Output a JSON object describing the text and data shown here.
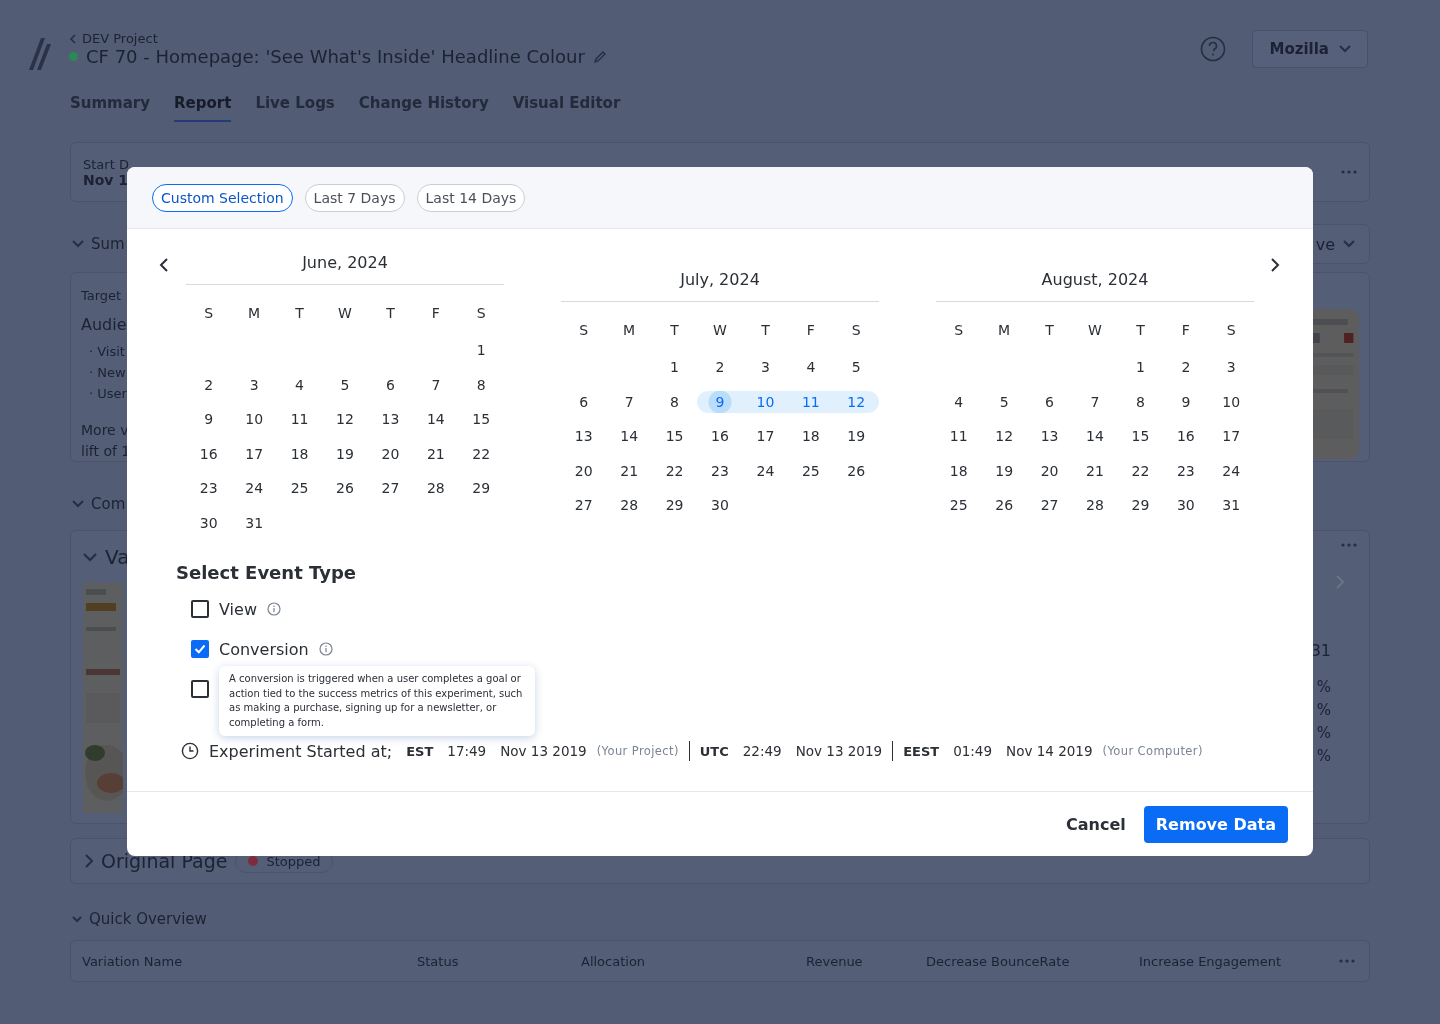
{
  "header": {
    "breadcrumb": "DEV Project",
    "title": "CF 70 - Homepage: 'See What's Inside' Headline Colour",
    "account": "Mozilla"
  },
  "tabs": [
    {
      "label": "Summary",
      "selected": false
    },
    {
      "label": "Report",
      "selected": true
    },
    {
      "label": "Live Logs",
      "selected": false
    },
    {
      "label": "Change History",
      "selected": false
    },
    {
      "label": "Visual Editor",
      "selected": false
    }
  ],
  "stats": {
    "label": "Start D",
    "value": "Nov 1"
  },
  "summary": {
    "title": "Sum",
    "dropdown": "ve",
    "lines": [
      {
        "kind": "label",
        "text": "Target"
      },
      {
        "kind": "heading",
        "text": "Audie"
      },
      {
        "kind": "bullet",
        "text": "· Visit"
      },
      {
        "kind": "bullet",
        "text": "· New"
      },
      {
        "kind": "bullet",
        "text": "· User"
      },
      {
        "kind": "para",
        "text": "More v"
      },
      {
        "kind": "para",
        "text": "lift of 1"
      }
    ]
  },
  "comparison": {
    "title": "Com",
    "variation": "Va",
    "values": [
      "31",
      "%",
      "%",
      "%",
      "%"
    ]
  },
  "original_page": {
    "title": "Original Page",
    "status": "Stopped"
  },
  "quick_overview": {
    "title": "Quick Overview",
    "columns": [
      "Variation Name",
      "Status",
      "Allocation",
      "Revenue",
      "Decrease BounceRate",
      "Increase Engagement"
    ]
  },
  "modal": {
    "presets": [
      {
        "label": "Custom Selection",
        "selected": true
      },
      {
        "label": "Last 7 Days",
        "selected": false
      },
      {
        "label": "Last 14 Days",
        "selected": false
      }
    ],
    "months": [
      {
        "title": "June, 2024",
        "weekdays": [
          "S",
          "M",
          "T",
          "W",
          "T",
          "F",
          "S"
        ],
        "weeks": [
          {
            "kind": "first",
            "days": [
              {
                "label": "1",
                "selected": false
              }
            ]
          },
          {
            "kind": "week",
            "days": [
              {
                "label": "2",
                "selected": false
              },
              {
                "label": "3",
                "selected": false
              },
              {
                "label": "4",
                "selected": false
              },
              {
                "label": "5",
                "selected": false
              },
              {
                "label": "6",
                "selected": false
              },
              {
                "label": "7",
                "selected": false
              },
              {
                "label": "8",
                "selected": false
              }
            ]
          },
          {
            "kind": "week",
            "days": [
              {
                "label": "9",
                "selected": false
              },
              {
                "label": "10",
                "selected": false
              },
              {
                "label": "11",
                "selected": false
              },
              {
                "label": "12",
                "selected": false
              },
              {
                "label": "13",
                "selected": false
              },
              {
                "label": "14",
                "selected": false
              },
              {
                "label": "15",
                "selected": false
              }
            ]
          },
          {
            "kind": "week",
            "days": [
              {
                "label": "16",
                "selected": false
              },
              {
                "label": "17",
                "selected": false
              },
              {
                "label": "18",
                "selected": false
              },
              {
                "label": "19",
                "selected": false
              },
              {
                "label": "20",
                "selected": false
              },
              {
                "label": "21",
                "selected": false
              },
              {
                "label": "22",
                "selected": false
              }
            ]
          },
          {
            "kind": "week",
            "days": [
              {
                "label": "23",
                "selected": false
              },
              {
                "label": "24",
                "selected": false
              },
              {
                "label": "25",
                "selected": false
              },
              {
                "label": "26",
                "selected": false
              },
              {
                "label": "27",
                "selected": false
              },
              {
                "label": "28",
                "selected": false
              },
              {
                "label": "29",
                "selected": false
              }
            ]
          },
          {
            "kind": "week",
            "days": [
              {
                "label": "30",
                "selected": false
              },
              {
                "label": "31",
                "selected": false
              }
            ]
          }
        ]
      },
      {
        "title": "July, 2024",
        "weekdays": [
          "S",
          "M",
          "T",
          "W",
          "T",
          "F",
          "S"
        ],
        "weeks": [
          {
            "kind": "first",
            "days": [
              {
                "label": "1",
                "selected": false
              },
              {
                "label": "2",
                "selected": false
              },
              {
                "label": "3",
                "selected": false
              },
              {
                "label": "4",
                "selected": false
              },
              {
                "label": "5",
                "selected": false
              }
            ]
          },
          {
            "kind": "week",
            "days": [
              {
                "label": "6",
                "selected": false
              },
              {
                "label": "7",
                "selected": false
              },
              {
                "label": "8",
                "selected": false
              },
              {
                "label": "9",
                "selected": true
              },
              {
                "label": "10",
                "selected": true
              },
              {
                "label": "11",
                "selected": true
              },
              {
                "label": "12",
                "selected": true
              }
            ]
          },
          {
            "kind": "week",
            "days": [
              {
                "label": "13",
                "selected": false
              },
              {
                "label": "14",
                "selected": false
              },
              {
                "label": "15",
                "selected": false
              },
              {
                "label": "16",
                "selected": false
              },
              {
                "label": "17",
                "selected": false
              },
              {
                "label": "18",
                "selected": false
              },
              {
                "label": "19",
                "selected": false
              }
            ]
          },
          {
            "kind": "week",
            "days": [
              {
                "label": "20",
                "selected": false
              },
              {
                "label": "21",
                "selected": false
              },
              {
                "label": "22",
                "selected": false
              },
              {
                "label": "23",
                "selected": false
              },
              {
                "label": "24",
                "selected": false
              },
              {
                "label": "25",
                "selected": false
              },
              {
                "label": "26",
                "selected": false
              }
            ]
          },
          {
            "kind": "week",
            "days": [
              {
                "label": "27",
                "selected": false
              },
              {
                "label": "28",
                "selected": false
              },
              {
                "label": "29",
                "selected": false
              },
              {
                "label": "30",
                "selected": false
              }
            ]
          }
        ]
      },
      {
        "title": "August, 2024",
        "weekdays": [
          "S",
          "M",
          "T",
          "W",
          "T",
          "F",
          "S"
        ],
        "weeks": [
          {
            "kind": "first",
            "days": [
              {
                "label": "1",
                "selected": false
              },
              {
                "label": "2",
                "selected": false
              },
              {
                "label": "3",
                "selected": false
              }
            ]
          },
          {
            "kind": "week",
            "days": [
              {
                "label": "4",
                "selected": false
              },
              {
                "label": "5",
                "selected": false
              },
              {
                "label": "6",
                "selected": false
              },
              {
                "label": "7",
                "selected": false
              },
              {
                "label": "8",
                "selected": false
              },
              {
                "label": "9",
                "selected": false
              },
              {
                "label": "10",
                "selected": false
              }
            ]
          },
          {
            "kind": "week",
            "days": [
              {
                "label": "11",
                "selected": false
              },
              {
                "label": "12",
                "selected": false
              },
              {
                "label": "13",
                "selected": false
              },
              {
                "label": "14",
                "selected": false
              },
              {
                "label": "15",
                "selected": false
              },
              {
                "label": "16",
                "selected": false
              },
              {
                "label": "17",
                "selected": false
              }
            ]
          },
          {
            "kind": "week",
            "days": [
              {
                "label": "18",
                "selected": false
              },
              {
                "label": "19",
                "selected": false
              },
              {
                "label": "20",
                "selected": false
              },
              {
                "label": "21",
                "selected": false
              },
              {
                "label": "22",
                "selected": false
              },
              {
                "label": "23",
                "selected": false
              },
              {
                "label": "24",
                "selected": false
              }
            ]
          },
          {
            "kind": "week",
            "days": [
              {
                "label": "25",
                "selected": false
              },
              {
                "label": "26",
                "selected": false
              },
              {
                "label": "27",
                "selected": false
              },
              {
                "label": "28",
                "selected": false
              },
              {
                "label": "29",
                "selected": false
              },
              {
                "label": "30",
                "selected": false
              },
              {
                "label": "31",
                "selected": false
              }
            ]
          }
        ]
      }
    ],
    "event_type": {
      "title": "Select Event Type",
      "options": [
        {
          "label": "View",
          "checked": false
        },
        {
          "label": "Conversion",
          "checked": true
        },
        {
          "checked": false
        }
      ],
      "tooltip": "A conversion is triggered when a user completes a goal or action tied to the success metrics of this experiment, such as making a purchase, signing up for a newsletter, or completing a form."
    },
    "started": {
      "label": "Experiment Started at;",
      "zones": [
        {
          "zone": "EST",
          "time": "17:49",
          "date": "Nov 13 2019",
          "note": "(Your Project)"
        },
        {
          "zone": "UTC",
          "time": "22:49",
          "date": "Nov 13 2019"
        },
        {
          "zone": "EEST",
          "time": "01:49",
          "date": "Nov 14 2019",
          "note": "(Your Computer)"
        }
      ]
    },
    "cancel": "Cancel",
    "confirm": "Remove Data"
  }
}
